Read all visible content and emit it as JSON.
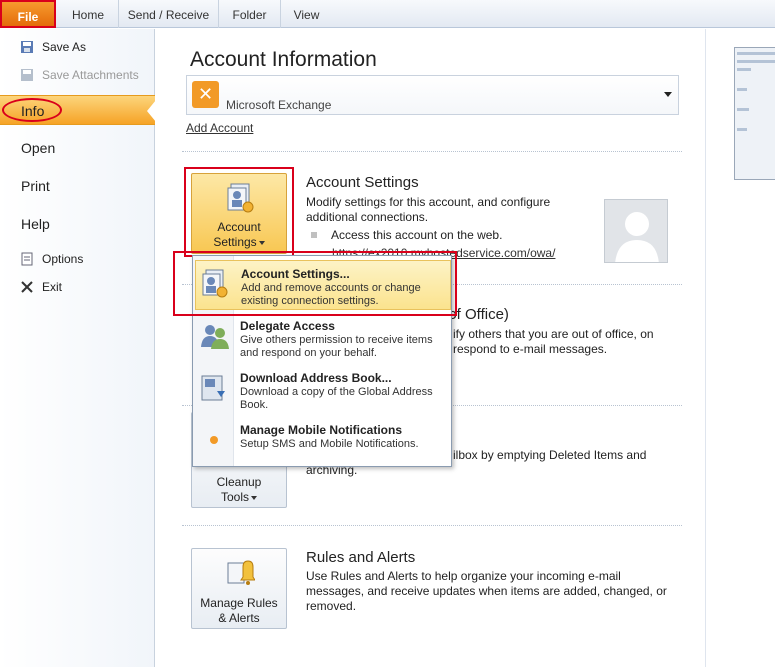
{
  "ribbon": {
    "tabs": [
      "File",
      "Home",
      "Send / Receive",
      "Folder",
      "View"
    ]
  },
  "nav": {
    "commands_top": [
      "Save As",
      "Save Attachments"
    ],
    "items": [
      "Info",
      "Open",
      "Print",
      "Help"
    ],
    "commands_bottom": [
      "Options",
      "Exit"
    ]
  },
  "main": {
    "title": "Account Information",
    "account_selector": "Microsoft Exchange",
    "add_account": "Add Account",
    "account_settings": {
      "button_line1": "Account",
      "button_line2": "Settings",
      "title": "Account Settings",
      "desc": "Modify settings for this account, and configure additional connections.",
      "bullet": "Access this account on the web.",
      "link": "https://ex2010.myhostedservice.com/owa/"
    },
    "automatic_replies": {
      "title_fragment": "t of Office)",
      "desc_line1": "ify others that you are out of office, on",
      "desc_line2": "respond to e-mail messages."
    },
    "cleanup": {
      "button_line1": "Cleanup",
      "button_line2": "Tools",
      "desc_line1": "ilbox by emptying Deleted Items and",
      "desc_line2": "archiving."
    },
    "rules": {
      "button_line1": "Manage Rules",
      "button_line2": "& Alerts",
      "title": "Rules and Alerts",
      "desc": "Use Rules and Alerts to help organize your incoming e-mail messages, and receive updates when items are added, changed, or removed."
    }
  },
  "menu": {
    "items": [
      {
        "title": "Account Settings...",
        "desc": "Add and remove accounts or change existing connection settings."
      },
      {
        "title": "Delegate Access",
        "desc": "Give others permission to receive items and respond on your behalf."
      },
      {
        "title": "Download Address Book...",
        "desc": "Download a copy of the Global Address Book."
      },
      {
        "title": "Manage Mobile Notifications",
        "desc": "Setup SMS and Mobile Notifications."
      }
    ]
  },
  "colors": {
    "accent_orange": "#f6a326",
    "file_tab": "#e46c0a",
    "highlight_red": "#d9001b"
  }
}
